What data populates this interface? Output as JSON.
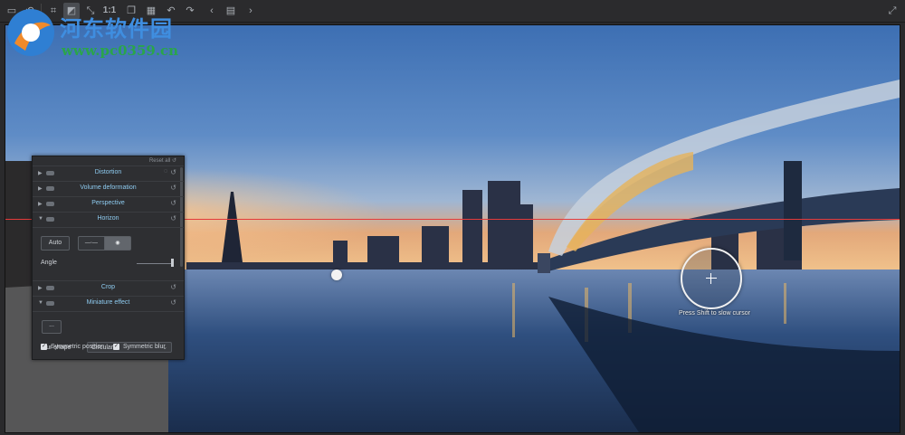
{
  "toolbar": {
    "zoom_label": "1:1",
    "icons": [
      "open-icon",
      "rotate-icon",
      "crop-icon",
      "compare-icon",
      "fit-icon",
      "one-to-one-icon",
      "copy-icon",
      "grid-icon",
      "undo-icon",
      "redo-icon",
      "prev-icon",
      "layout-icon",
      "next-icon",
      "fullscreen-icon"
    ]
  },
  "watermark": {
    "title": "河东软件园",
    "url": "www.pc0359.cn"
  },
  "panel": {
    "reset_all": "Reset all",
    "sections": {
      "distortion": "Distortion",
      "volume": "Volume deformation",
      "perspective": "Perspective",
      "horizon": "Horizon",
      "crop": "Crop",
      "miniature": "Miniature effect"
    },
    "horizon": {
      "auto": "Auto",
      "angle_label": "Angle"
    },
    "miniature": {
      "dots_button": "...",
      "blur_shape_label": "Blur shape",
      "blur_shape_value": "Circular",
      "symmetric_position": "Symmetric position",
      "symmetric_blur": "Symmetric blur"
    }
  },
  "canvas": {
    "hint": "Press Shift to slow cursor",
    "horizon_color": "#e43b3b"
  }
}
